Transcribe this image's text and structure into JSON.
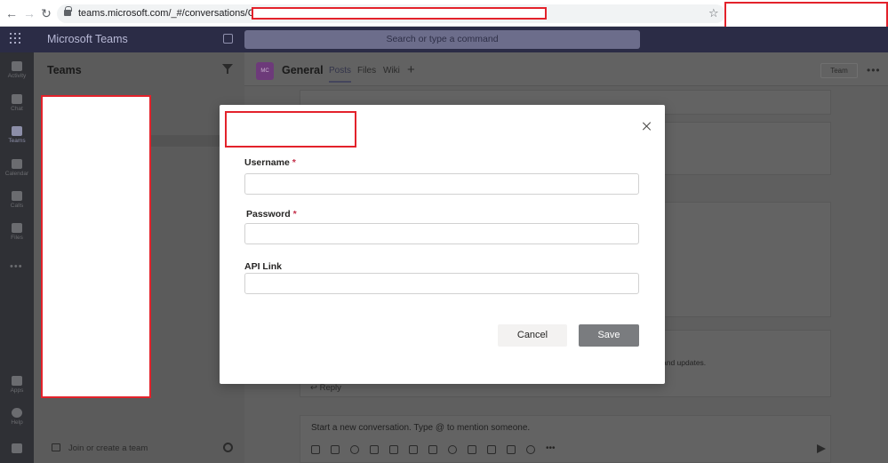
{
  "browser": {
    "url": "teams.microsoft.com/_#/conversations/General"
  },
  "app": {
    "name": "Microsoft Teams",
    "search_placeholder": "Search or type a command"
  },
  "rail": {
    "items": [
      {
        "label": "Activity"
      },
      {
        "label": "Chat"
      },
      {
        "label": "Teams"
      },
      {
        "label": "Calendar"
      },
      {
        "label": "Calls"
      },
      {
        "label": "Files"
      },
      {
        "label": "Apps"
      },
      {
        "label": "Help"
      }
    ]
  },
  "teams_panel": {
    "title": "Teams",
    "join_label": "Join or create a team"
  },
  "channel": {
    "avatar": "MC",
    "name": "General",
    "tabs": [
      "Posts",
      "Files",
      "Wiki"
    ],
    "team_button": "Team",
    "reply_label": "Reply",
    "card_snippet": "and updates.",
    "compose_placeholder": "Start a new conversation. Type @ to mention someone."
  },
  "modal": {
    "fields": [
      {
        "label": "Username",
        "required": "*",
        "value": ""
      },
      {
        "label": "Password",
        "required": "*",
        "value": ""
      },
      {
        "label": "API Link",
        "value": ""
      }
    ],
    "cancel_label": "Cancel",
    "save_label": "Save"
  },
  "colors": {
    "header": "#464775",
    "required": "#c4314b",
    "redaction_border": "#e3222b",
    "save_button": "#7a7c7f"
  }
}
